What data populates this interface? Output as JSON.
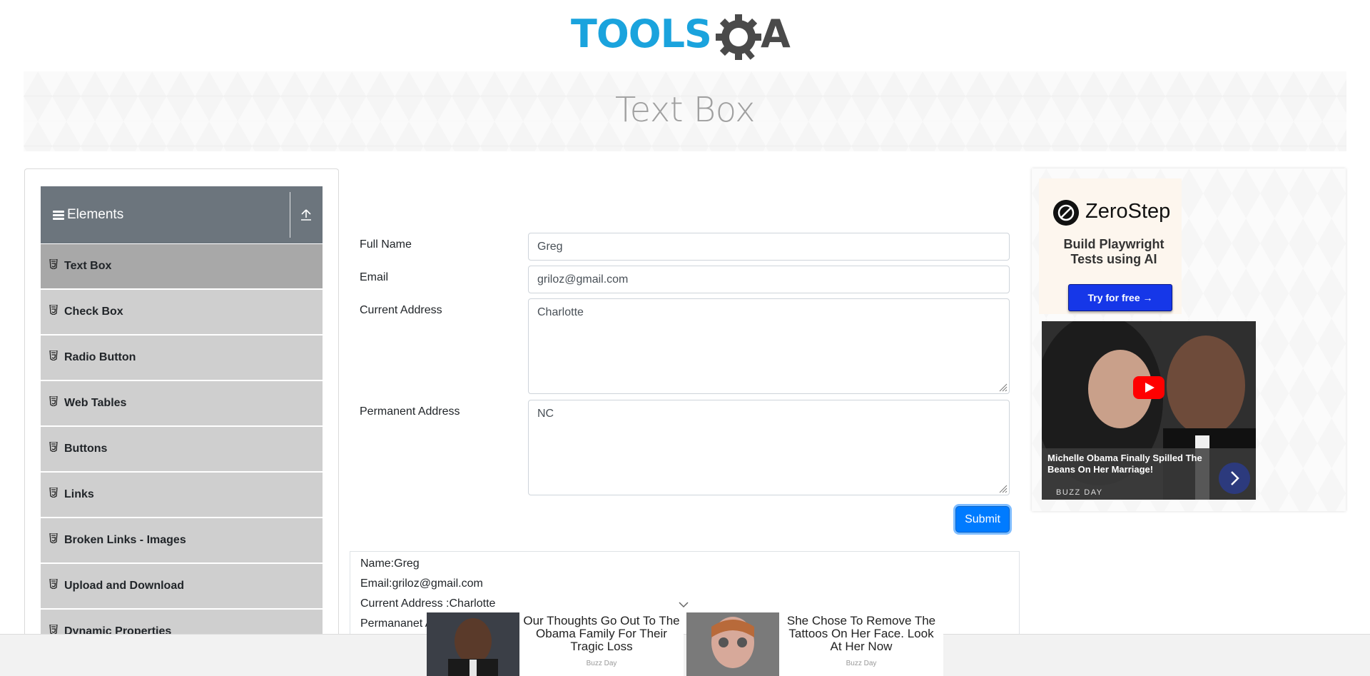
{
  "header": {
    "logo_text_primary": "TOOLS",
    "logo_text_secondary": "QA"
  },
  "banner": {
    "title": "Text Box"
  },
  "sidebar": {
    "group_title": "Elements",
    "items": [
      {
        "label": "Text Box",
        "active": true
      },
      {
        "label": "Check Box"
      },
      {
        "label": "Radio Button"
      },
      {
        "label": "Web Tables"
      },
      {
        "label": "Buttons"
      },
      {
        "label": "Links"
      },
      {
        "label": "Broken Links - Images"
      },
      {
        "label": "Upload and Download"
      },
      {
        "label": "Dynamic Properties"
      }
    ]
  },
  "form": {
    "full_name_label": "Full Name",
    "full_name_value": "Greg",
    "email_label": "Email",
    "email_value": "griloz@gmail.com",
    "current_address_label": "Current Address",
    "current_address_value": "Charlotte",
    "permanent_address_label": "Permanent Address",
    "permanent_address_value": "NC",
    "submit_label": "Submit"
  },
  "output": {
    "name_line": "Name:Greg",
    "email_line": "Email:griloz@gmail.com",
    "current_address_line": "Current Address :Charlotte",
    "permanent_address_line": "Permananet Address :NC"
  },
  "ad_right": {
    "brand": "ZeroStep",
    "tagline": "Build Playwright Tests using AI",
    "cta": "Try for free →",
    "video_headline": "Michelle Obama Finally Spilled The Beans On Her Marriage!",
    "video_source": "BUZZ DAY"
  },
  "bottom_ads": [
    {
      "headline": "Our Thoughts Go Out To The Obama Family For Their Tragic Loss",
      "source": "Buzz Day"
    },
    {
      "headline": "She Chose To Remove The Tattoos On Her Face. Look At Her Now",
      "source": "Buzz Day"
    }
  ],
  "colors": {
    "accent": "#007bff",
    "sidebar_header": "#6c757d",
    "sidebar_item": "#cfcfcf",
    "sidebar_item_active": "#a8a8a8",
    "logo_blue": "#1aa3dd",
    "logo_dark": "#4a4a4a"
  },
  "icons": [
    "hamburger-icon",
    "collapse-arrow-icon",
    "html5-badge-icon",
    "resize-grip-icon",
    "play-icon",
    "chevron-right-icon",
    "chevron-down-icon"
  ]
}
